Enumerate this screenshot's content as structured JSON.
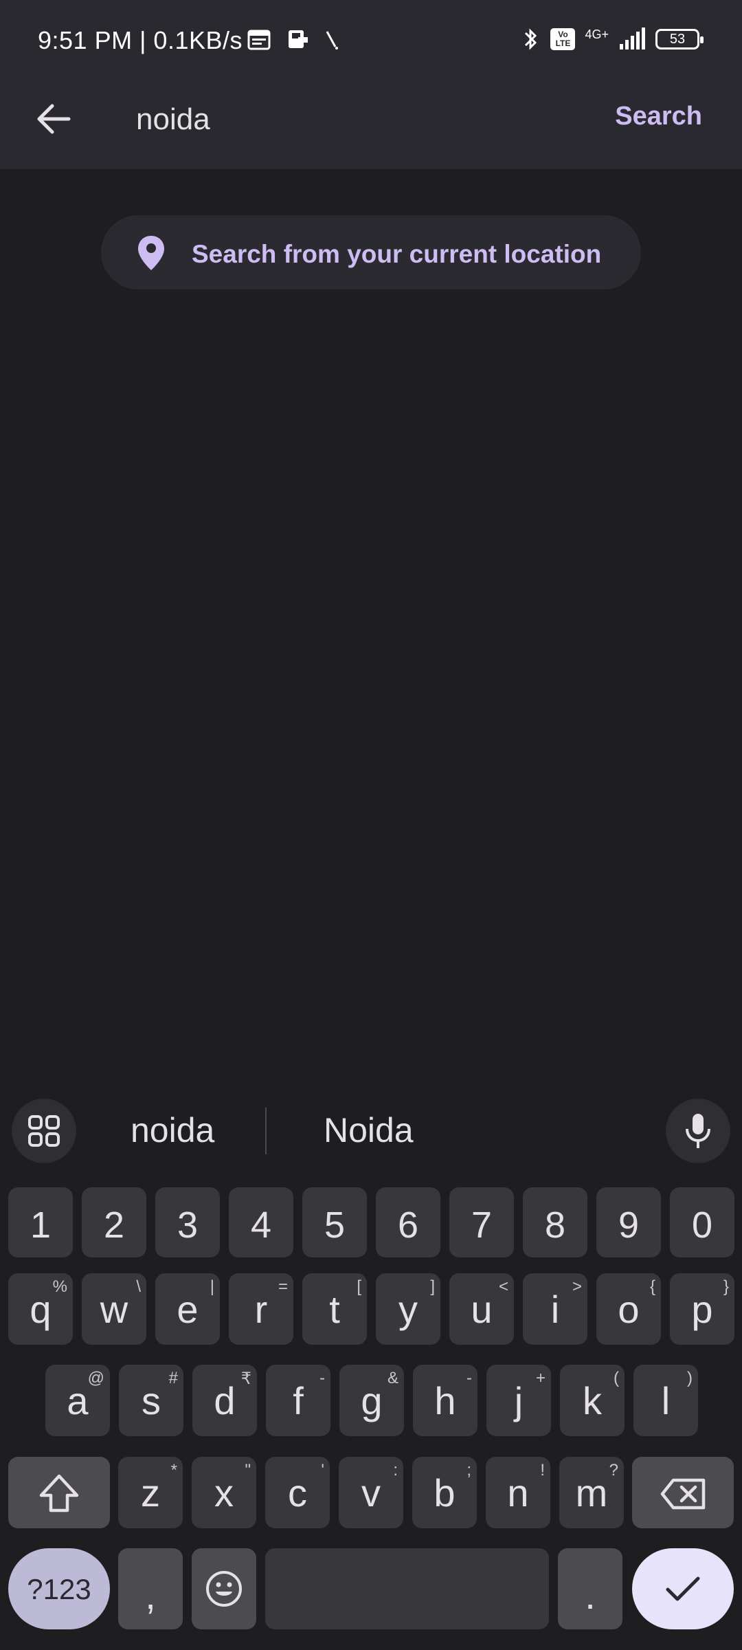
{
  "status_bar": {
    "time_speed": "9:51 PM | 0.1KB/s",
    "battery": "53",
    "network_label": "4G+",
    "volte_label": "Vo LTE"
  },
  "top_bar": {
    "query": "noida",
    "search_label": "Search"
  },
  "location_chip": {
    "label": "Search from your current location"
  },
  "keyboard": {
    "suggestions": [
      "noida",
      "Noida"
    ],
    "number_row": [
      "1",
      "2",
      "3",
      "4",
      "5",
      "6",
      "7",
      "8",
      "9",
      "0"
    ],
    "row1": [
      {
        "k": "q",
        "h": "%"
      },
      {
        "k": "w",
        "h": "\\"
      },
      {
        "k": "e",
        "h": "|"
      },
      {
        "k": "r",
        "h": "="
      },
      {
        "k": "t",
        "h": "["
      },
      {
        "k": "y",
        "h": "]"
      },
      {
        "k": "u",
        "h": "<"
      },
      {
        "k": "i",
        "h": ">"
      },
      {
        "k": "o",
        "h": "{"
      },
      {
        "k": "p",
        "h": "}"
      }
    ],
    "row2": [
      {
        "k": "a",
        "h": "@"
      },
      {
        "k": "s",
        "h": "#"
      },
      {
        "k": "d",
        "h": "₹"
      },
      {
        "k": "f",
        "h": "-"
      },
      {
        "k": "g",
        "h": "&"
      },
      {
        "k": "h",
        "h": "-"
      },
      {
        "k": "j",
        "h": "+"
      },
      {
        "k": "k",
        "h": "("
      },
      {
        "k": "l",
        "h": ")"
      }
    ],
    "row3": [
      {
        "k": "z",
        "h": "*"
      },
      {
        "k": "x",
        "h": "\""
      },
      {
        "k": "c",
        "h": "'"
      },
      {
        "k": "v",
        "h": ":"
      },
      {
        "k": "b",
        "h": ";"
      },
      {
        "k": "n",
        "h": "!"
      },
      {
        "k": "m",
        "h": "?"
      }
    ],
    "symbols_label": "?123",
    "comma_label": ",",
    "period_label": "."
  },
  "colors": {
    "accent": "#cdbdf3",
    "background": "#1e1e21",
    "bar": "#2a2930",
    "key": "#37373c",
    "enter_key": "#e7e3fb"
  }
}
